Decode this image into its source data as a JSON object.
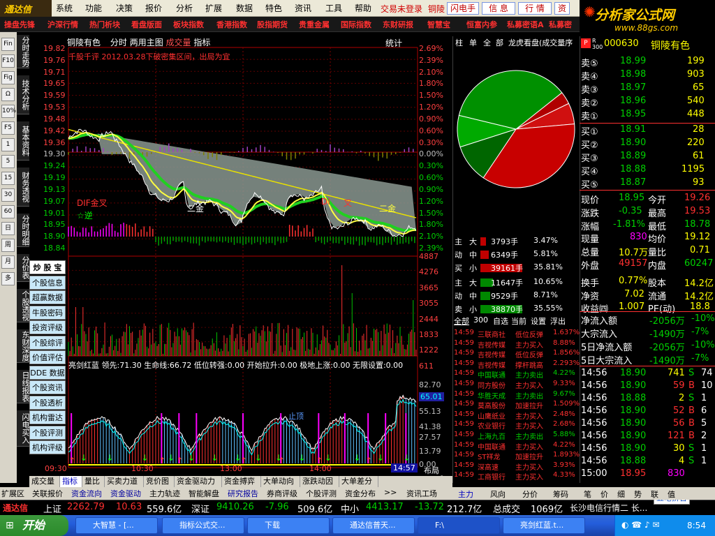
{
  "app": {
    "logo": "通达信",
    "trade_login": "交易未登录",
    "stock_short": "铜陵"
  },
  "menu": [
    "系统",
    "功能",
    "决策",
    "报价",
    "分析",
    "扩展",
    "数据",
    "特色",
    "资讯",
    "工具",
    "帮助"
  ],
  "menu_buttons": [
    "闪电手",
    "信 息",
    "行 情",
    "资"
  ],
  "brand": {
    "title": "分析家公式网",
    "url": "www.88gs.com"
  },
  "funcbar": [
    "操盘先锋",
    "沪深行情",
    "热门析块",
    "看盘版面",
    "板块指数",
    "香港指数",
    "股指期货",
    "贵重金属",
    "国际指数",
    "东财研报",
    "智慧宝",
    "恒富内参",
    "私募密语A",
    "私募密"
  ],
  "vtabs": [
    "分时走势",
    "技术分析",
    "基本资料",
    "财务透视",
    "分时明细",
    "分价表",
    "个股透视",
    "东财深度",
    "日线报表",
    "闪电买入"
  ],
  "side_icons": [
    "Fin",
    "F10",
    "Fig",
    "Ω",
    "10%",
    "F5",
    "1",
    "5",
    "15",
    "30",
    "60",
    "日",
    "周",
    "月",
    "多"
  ],
  "chart": {
    "stock_name": "铜陵有色",
    "mode": "分时",
    "header_rest": "两用主图",
    "vol_label": "成交量",
    "ind_label": "指标",
    "stat": "统计",
    "note": "千股千评 2012.03.28下破密集区间，出局为宜",
    "label_dif": "DIF金叉",
    "label_ni": "☆逆",
    "label_erjin1": "二金",
    "label_dif2": "DI",
    "label_cha": "叉",
    "label_erjin2": "二金",
    "label_zhiding": "止顶",
    "price_ticks": [
      "19.82",
      "19.76",
      "19.71",
      "19.65",
      "19.59",
      "19.53",
      "19.48",
      "19.42",
      "19.36",
      "19.30",
      "19.24",
      "19.19",
      "19.13",
      "19.07",
      "19.01",
      "18.95",
      "18.90",
      "18.84"
    ],
    "pct_ticks": [
      "2.69%",
      "2.39%",
      "2.10%",
      "1.80%",
      "1.50%",
      "1.20%",
      "0.90%",
      "0.60%",
      "0.30%",
      "0.00%",
      "0.30%",
      "0.60%",
      "0.90%",
      "1.20%",
      "1.50%",
      "1.80%",
      "2.10%",
      "2.39%"
    ],
    "vol_ticks": [
      "4887",
      "4276",
      "3665",
      "3055",
      "2444",
      "1833",
      "1222",
      "611"
    ],
    "ind_header": "亮剑红蓝  领先:71.30  生命线:66.72  低位转强:0.00  开始拉升:0.00  极地上涨:0.00  无限设置:0.00",
    "ind_ticks": [
      "82.70",
      "65.01",
      "55.13",
      "41.38",
      "27.57",
      "13.79",
      "0.00"
    ],
    "time_ticks": [
      "09:30",
      "10:30",
      "13:00",
      "14:00"
    ],
    "cur_time": "14:57",
    "buju": "布局"
  },
  "toolbox": [
    "炒 股 宝",
    "个股信息",
    "超赢数据",
    "牛股密码",
    "投资评级",
    "个股综评",
    "价值评估",
    "DDE 数据",
    "个股资讯",
    "个股透析",
    "机构雷达",
    "个股评测",
    "机构评级"
  ],
  "bottom_tabs": [
    "成交量",
    "指标",
    "量比",
    "买卖力道",
    "竞价图",
    "资金驱动力",
    "资金搏弈",
    "大单动向",
    "涨跌动因",
    "大单差分"
  ],
  "bottom_extra": [
    "扩展区",
    "关联报价",
    "资金流向",
    "资金驱动",
    "主力轨迹",
    "智能解盘",
    "研究报告",
    "券商评级",
    "个股评测",
    "资金分布",
    ">>",
    "资讯工场"
  ],
  "mid": {
    "tabs": [
      "柱",
      "单",
      "全",
      "部",
      "龙虎看盘(成交量序"
    ],
    "flows": [
      {
        "side": "主",
        "size": "大",
        "hands": "3793手",
        "pct": "3.47%"
      },
      {
        "side": "动",
        "size": "中",
        "hands": "6349手",
        "pct": "5.81%"
      },
      {
        "side": "买",
        "size": "小",
        "hands": "39161手",
        "pct": "35.81%"
      },
      {
        "side": "主",
        "size": "大",
        "hands": "11647手",
        "pct": "10.65%"
      },
      {
        "side": "动",
        "size": "中",
        "hands": "9529手",
        "pct": "8.71%"
      },
      {
        "side": "卖",
        "size": "小",
        "hands": "38870手",
        "pct": "35.55%"
      }
    ],
    "list_tabs": [
      "全部",
      "300",
      "自选",
      "当前",
      "设置",
      "浮出"
    ],
    "alerts": [
      [
        "14:59",
        "三联商社",
        "低位反弹",
        "1.637%"
      ],
      [
        "14:59",
        "吉视传媒",
        "主力买入",
        "8.88%"
      ],
      [
        "14:59",
        "吉视传媒",
        "低位反弹",
        "1.856%"
      ],
      [
        "14:59",
        "吉视传媒",
        "撑杆跳高",
        "2.293%"
      ],
      [
        "14:59",
        "中国联通",
        "主力卖出",
        "4.22%"
      ],
      [
        "14:59",
        "同方股份",
        "主力买入",
        "9.33%"
      ],
      [
        "14:59",
        "华胜天成",
        "主力卖出",
        "9.67%"
      ],
      [
        "14:59",
        "莫高股份",
        "加速拉升",
        "1.509%"
      ],
      [
        "14:59",
        "山鹰纸业",
        "主力买入",
        "2.48%"
      ],
      [
        "14:59",
        "农业银行",
        "主力买入",
        "2.68%"
      ],
      [
        "14:59",
        "上海九百",
        "主力卖出",
        "5.88%"
      ],
      [
        "14:59",
        "中国联通",
        "主力买入",
        "4.22%"
      ],
      [
        "14:59",
        "ST祥龙",
        "加速拉升",
        "1.893%"
      ],
      [
        "14:59",
        "深高速",
        "主力买入",
        "3.93%"
      ],
      [
        "14:59",
        "工商银行",
        "主力买入",
        "4.33%"
      ]
    ],
    "bottom_tabs": [
      "主力",
      "风向",
      "分价",
      "筹码"
    ]
  },
  "quote": {
    "code": "000630",
    "name": "铜陵有色",
    "sells": [
      [
        "卖⑤",
        "18.99",
        "199"
      ],
      [
        "卖④",
        "18.98",
        "903"
      ],
      [
        "卖③",
        "18.97",
        "65"
      ],
      [
        "卖②",
        "18.96",
        "540"
      ],
      [
        "卖①",
        "18.95",
        "448"
      ]
    ],
    "buys": [
      [
        "买①",
        "18.91",
        "28"
      ],
      [
        "买②",
        "18.90",
        "220"
      ],
      [
        "买③",
        "18.89",
        "61"
      ],
      [
        "买④",
        "18.88",
        "1195"
      ],
      [
        "买⑤",
        "18.87",
        "93"
      ]
    ],
    "stats": [
      [
        "现价",
        "18.95",
        "今开",
        "19.26"
      ],
      [
        "涨跌",
        "-0.35",
        "最高",
        "19.53"
      ],
      [
        "涨幅",
        "-1.81%",
        "最低",
        "18.78"
      ],
      [
        "现量",
        "830",
        "均价",
        "19.12"
      ],
      [
        "总量",
        "10.7万",
        "量比",
        "0.71"
      ],
      [
        "外盘",
        "49157",
        "内盘",
        "60247"
      ],
      [
        "换手",
        "0.77%",
        "股本",
        "14.2亿"
      ],
      [
        "净资",
        "7.02",
        "流通",
        "14.2亿"
      ],
      [
        "收益㈣",
        "1.007",
        "PE(动)",
        "18.8"
      ]
    ],
    "flows": [
      [
        "净流入额",
        "-2056万",
        "-10%"
      ],
      [
        "大宗流入",
        "-1490万",
        "-7%"
      ],
      [
        "5日净流入额",
        "-2056万",
        "-10%"
      ],
      [
        "5日大宗流入",
        "-1490万",
        "-7%"
      ]
    ],
    "ticks": [
      [
        "14:56",
        "18.90",
        "741",
        "S",
        "74"
      ],
      [
        "14:56",
        "18.90",
        "59",
        "B",
        "10"
      ],
      [
        "14:56",
        "18.88",
        "2",
        "S",
        "1"
      ],
      [
        "14:56",
        "18.90",
        "52",
        "B",
        "6"
      ],
      [
        "14:56",
        "18.90",
        "56",
        "B",
        "5"
      ],
      [
        "14:56",
        "18.90",
        "121",
        "B",
        "2"
      ],
      [
        "14:56",
        "18.90",
        "30",
        "S",
        "1"
      ],
      [
        "14:56",
        "18.88",
        "4",
        "S",
        "1"
      ],
      [
        "15:00",
        "18.95",
        "830",
        "",
        ""
      ]
    ],
    "bottom_tabs": [
      "笔",
      "价",
      "细",
      "势",
      "联",
      "值"
    ]
  },
  "statusbar": {
    "logo": "通达信",
    "sh_label": "上证",
    "sh_val": "2262.79",
    "sh_chg": "10.63",
    "sh_amt": "559.6亿",
    "sz_label": "深证",
    "sz_val": "9410.26",
    "sz_chg": "-7.96",
    "sz_amt": "509.6亿",
    "zx_label": "中小",
    "zx_val": "4413.17",
    "zx_chg": "-13.72",
    "zx_amt": "212.7亿",
    "tot_label": "总成交",
    "tot_val": "1069亿",
    "msg": "长沙电信行情二 长...",
    "ime": "五笔拼音"
  },
  "taskbar": {
    "start": "开始",
    "tasks": [
      "大智慧 - [...",
      "指标公式交...",
      "下载",
      "通达信普天...",
      "F:\\",
      "亮剑红蓝.t..."
    ],
    "clock": "8:54"
  },
  "pie_data": [
    {
      "label": "主动买大",
      "pct": 3.47,
      "color": "#b00000"
    },
    {
      "label": "主动买中",
      "pct": 5.81,
      "color": "#d01010"
    },
    {
      "label": "主动买小",
      "pct": 35.81,
      "color": "#c80000"
    },
    {
      "label": "主动卖大",
      "pct": 10.65,
      "color": "#006600"
    },
    {
      "label": "主动卖中",
      "pct": 8.71,
      "color": "#00aa00"
    },
    {
      "label": "主动卖小",
      "pct": 35.55,
      "color": "#009000"
    }
  ]
}
